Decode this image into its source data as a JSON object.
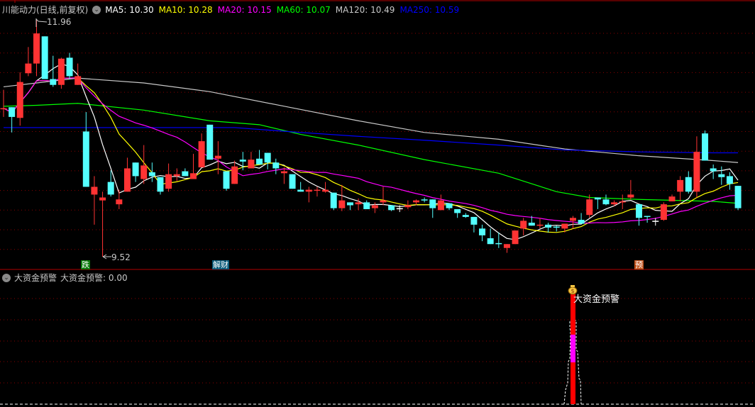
{
  "header": {
    "title": "川能动力(日线,前复权)",
    "ma": [
      {
        "label": "MA5: 10.30",
        "color": "#ffffff"
      },
      {
        "label": "MA10: 10.28",
        "color": "#ffff00"
      },
      {
        "label": "MA20: 10.15",
        "color": "#ff00ff"
      },
      {
        "label": "MA60: 10.07",
        "color": "#00ff00"
      },
      {
        "label": "MA120: 10.49",
        "color": "#c8c8c8"
      },
      {
        "label": "MA250: 10.59",
        "color": "#0000ff"
      }
    ]
  },
  "sub_panel": {
    "title": "大资金预警",
    "value_label": "大资金预警: 0.00",
    "signal_text": "大资金预警"
  },
  "markers": {
    "high_label": "11.96",
    "low_label": "9.52",
    "tag_die": "跌",
    "tag_jiecai": "解财",
    "tag_yu": "预"
  },
  "colors": {
    "up": "#ff3333",
    "down": "#54ffff",
    "grid": "#8b0000",
    "doji": "#ffffff"
  },
  "chart_data": {
    "type": "candlestick",
    "title": "川能动力(日线,前复权)",
    "ylim": [
      9.35,
      12.1
    ],
    "grid": true,
    "high": 11.96,
    "low": 9.52,
    "ohlc": [
      [
        11.04,
        11.24,
        10.96,
        11.05
      ],
      [
        11.06,
        11.06,
        10.8,
        10.96
      ],
      [
        10.95,
        11.42,
        10.87,
        11.32
      ],
      [
        11.41,
        11.68,
        11.38,
        11.51
      ],
      [
        11.51,
        11.96,
        11.38,
        11.82
      ],
      [
        11.79,
        11.79,
        11.35,
        11.35
      ],
      [
        11.35,
        11.59,
        11.27,
        11.29
      ],
      [
        11.29,
        11.57,
        11.25,
        11.56
      ],
      [
        11.57,
        11.62,
        11.35,
        11.38
      ],
      [
        11.29,
        11.51,
        11.29,
        11.38
      ],
      [
        10.81,
        11.01,
        10.24,
        10.24
      ],
      [
        10.16,
        10.35,
        9.85,
        10.24
      ],
      [
        10.1,
        10.19,
        9.52,
        10.13
      ],
      [
        10.29,
        10.41,
        10.14,
        10.16
      ],
      [
        10.06,
        10.21,
        10.01,
        10.11
      ],
      [
        10.19,
        10.54,
        10.19,
        10.43
      ],
      [
        10.49,
        10.49,
        10.29,
        10.35
      ],
      [
        10.32,
        10.67,
        10.27,
        10.46
      ],
      [
        10.39,
        10.49,
        10.29,
        10.35
      ],
      [
        10.34,
        10.34,
        10.16,
        10.19
      ],
      [
        10.22,
        10.48,
        10.19,
        10.37
      ],
      [
        10.35,
        10.43,
        10.3,
        10.37
      ],
      [
        10.4,
        10.43,
        10.35,
        10.35
      ],
      [
        10.32,
        10.58,
        10.32,
        10.38
      ],
      [
        10.44,
        10.79,
        10.44,
        10.71
      ],
      [
        10.88,
        10.88,
        10.52,
        10.52
      ],
      [
        10.53,
        10.71,
        10.37,
        10.56
      ],
      [
        10.4,
        10.4,
        10.2,
        10.22
      ],
      [
        10.27,
        10.51,
        10.27,
        10.45
      ],
      [
        10.52,
        10.6,
        10.41,
        10.5
      ],
      [
        10.43,
        10.6,
        10.43,
        10.52
      ],
      [
        10.53,
        10.62,
        10.47,
        10.47
      ],
      [
        10.59,
        10.59,
        10.42,
        10.49
      ],
      [
        10.49,
        10.53,
        10.37,
        10.43
      ],
      [
        10.38,
        10.44,
        10.27,
        10.4
      ],
      [
        10.37,
        10.37,
        10.22,
        10.22
      ],
      [
        10.21,
        10.29,
        10.19,
        10.19
      ],
      [
        10.19,
        10.24,
        10.08,
        10.21
      ],
      [
        10.2,
        10.24,
        10.14,
        10.21
      ],
      [
        10.19,
        10.29,
        10.18,
        10.21
      ],
      [
        10.18,
        10.18,
        10.0,
        10.02
      ],
      [
        10.02,
        10.26,
        9.99,
        10.1
      ],
      [
        10.08,
        10.08,
        10.0,
        10.05
      ],
      [
        10.06,
        10.12,
        10.0,
        10.08
      ],
      [
        10.08,
        10.1,
        10.01,
        10.01
      ],
      [
        10.02,
        10.08,
        9.97,
        10.05
      ],
      [
        10.08,
        10.24,
        10.05,
        10.1
      ],
      [
        10.05,
        10.05,
        9.99,
        10.0
      ],
      [
        10.02,
        10.05,
        9.98,
        10.02
      ],
      [
        10.03,
        10.1,
        10.01,
        10.05
      ],
      [
        10.08,
        10.11,
        10.05,
        10.1
      ],
      [
        10.11,
        10.13,
        10.08,
        10.1
      ],
      [
        10.11,
        10.11,
        9.92,
        10.02
      ],
      [
        10.0,
        10.16,
        10.0,
        10.1
      ],
      [
        10.07,
        10.07,
        10.0,
        10.02
      ],
      [
        10.01,
        10.01,
        9.92,
        9.97
      ],
      [
        9.95,
        9.97,
        9.92,
        9.93
      ],
      [
        9.93,
        9.93,
        9.77,
        9.85
      ],
      [
        9.81,
        9.85,
        9.68,
        9.74
      ],
      [
        9.71,
        9.81,
        9.65,
        9.65
      ],
      [
        9.66,
        9.77,
        9.61,
        9.65
      ],
      [
        9.61,
        9.65,
        9.56,
        9.65
      ],
      [
        9.65,
        9.79,
        9.65,
        9.79
      ],
      [
        9.81,
        9.92,
        9.74,
        9.89
      ],
      [
        9.87,
        9.94,
        9.84,
        9.84
      ],
      [
        9.84,
        9.92,
        9.81,
        9.85
      ],
      [
        9.85,
        9.87,
        9.77,
        9.82
      ],
      [
        9.83,
        9.84,
        9.78,
        9.82
      ],
      [
        9.81,
        9.86,
        9.77,
        9.86
      ],
      [
        9.89,
        9.94,
        9.81,
        9.92
      ],
      [
        9.9,
        9.97,
        9.86,
        9.86
      ],
      [
        9.95,
        10.16,
        9.92,
        10.11
      ],
      [
        10.13,
        10.13,
        10.01,
        10.11
      ],
      [
        10.11,
        10.16,
        10.05,
        10.06
      ],
      [
        10.06,
        10.1,
        10.04,
        10.08
      ],
      [
        10.08,
        10.16,
        10.01,
        10.09
      ],
      [
        10.13,
        10.31,
        10.11,
        10.16
      ],
      [
        10.06,
        10.06,
        9.84,
        9.92
      ],
      [
        9.94,
        9.94,
        9.87,
        9.93
      ],
      [
        9.89,
        9.92,
        9.84,
        9.89
      ],
      [
        9.9,
        10.08,
        9.89,
        10.06
      ],
      [
        10.09,
        10.16,
        10.09,
        10.14
      ],
      [
        10.19,
        10.35,
        10.09,
        10.31
      ],
      [
        10.34,
        10.4,
        10.17,
        10.19
      ],
      [
        10.19,
        10.76,
        10.13,
        10.6
      ],
      [
        10.79,
        10.82,
        10.51,
        10.51
      ],
      [
        10.43,
        10.47,
        10.32,
        10.4
      ],
      [
        10.37,
        10.45,
        10.26,
        10.34
      ],
      [
        10.35,
        10.39,
        10.21,
        10.27
      ],
      [
        10.25,
        10.25,
        10.0,
        10.02
      ]
    ],
    "ma_computed": [
      {
        "name": "MA5",
        "period": 5,
        "color": "#ffffff"
      },
      {
        "name": "MA10",
        "period": 10,
        "color": "#ffff00"
      },
      {
        "name": "MA20",
        "period": 20,
        "color": "#ff00ff"
      }
    ],
    "ma_anchors": [
      {
        "name": "MA60",
        "color": "#00ff00",
        "points": [
          [
            0,
            11.07
          ],
          [
            4,
            11.08
          ],
          [
            9,
            11.1
          ],
          [
            17,
            11.03
          ],
          [
            25,
            10.92
          ],
          [
            31,
            10.88
          ],
          [
            36,
            10.78
          ],
          [
            43,
            10.67
          ],
          [
            51,
            10.52
          ],
          [
            60,
            10.38
          ],
          [
            67,
            10.19
          ],
          [
            71,
            10.13
          ],
          [
            77,
            10.11
          ],
          [
            86,
            10.09
          ],
          [
            89,
            10.07
          ]
        ]
      },
      {
        "name": "MA120",
        "color": "#c8c8c8",
        "points": [
          [
            0,
            11.27
          ],
          [
            4,
            11.31
          ],
          [
            9,
            11.36
          ],
          [
            17,
            11.31
          ],
          [
            25,
            11.22
          ],
          [
            34,
            11.07
          ],
          [
            43,
            10.92
          ],
          [
            51,
            10.8
          ],
          [
            60,
            10.73
          ],
          [
            68,
            10.63
          ],
          [
            77,
            10.56
          ],
          [
            86,
            10.51
          ],
          [
            89,
            10.49
          ]
        ]
      },
      {
        "name": "MA250",
        "color": "#0000ff",
        "points": [
          [
            0,
            10.85
          ],
          [
            28,
            10.85
          ],
          [
            36,
            10.8
          ],
          [
            43,
            10.76
          ],
          [
            51,
            10.72
          ],
          [
            60,
            10.67
          ],
          [
            68,
            10.62
          ],
          [
            77,
            10.6
          ],
          [
            86,
            10.59
          ],
          [
            89,
            10.59
          ]
        ]
      }
    ],
    "signal": {
      "candle_index": 69,
      "value": 0.0
    }
  }
}
